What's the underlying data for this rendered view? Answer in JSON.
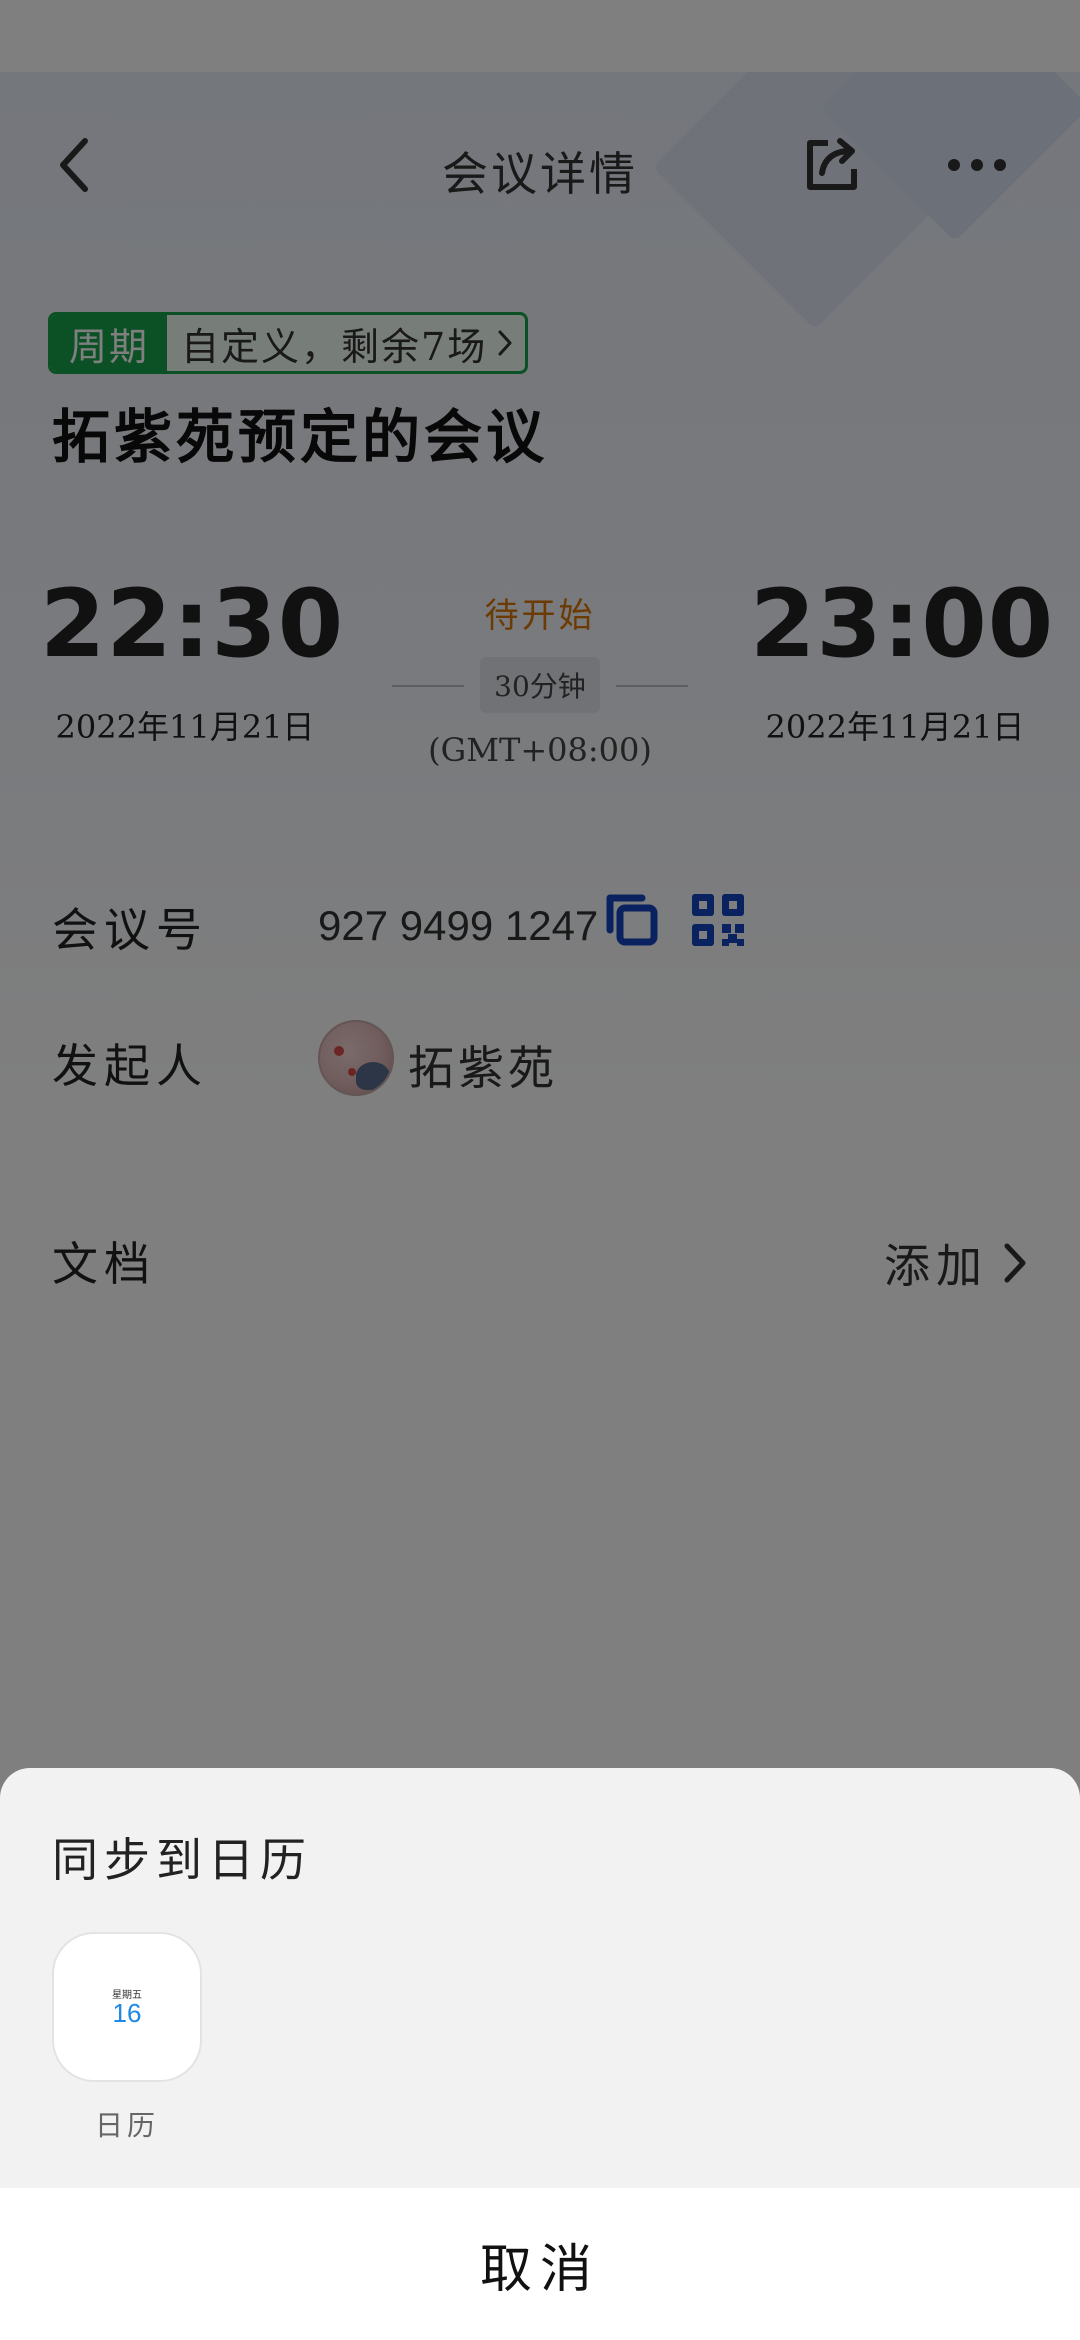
{
  "header": {
    "title": "会议详情"
  },
  "cycle": {
    "label": "周期",
    "text": "自定义，剩余7场"
  },
  "meeting": {
    "title": "拓紫苑预定的会议",
    "start": {
      "time": "22:30",
      "date": "2022年11月21日"
    },
    "end": {
      "time": "23:00",
      "date": "2022年11月21日"
    },
    "status": "待开始",
    "duration": "30分钟",
    "timezone": "(GMT+08:00)"
  },
  "details": {
    "meeting_id_label": "会议号",
    "meeting_id": "927 9499 1247",
    "organizer_label": "发起人",
    "organizer_name": "拓紫苑",
    "documents_label": "文档",
    "documents_action": "添加"
  },
  "sheet": {
    "title": "同步到日历",
    "apps": [
      {
        "label": "日历",
        "icon_weekday": "星期五",
        "icon_day": "16"
      }
    ],
    "cancel": "取消"
  },
  "colors": {
    "accent_green": "#16a34a",
    "status_orange": "#d97706",
    "action_blue": "#1447c0"
  },
  "icons": {
    "back": "chevron-left-icon",
    "share": "share-icon",
    "more": "more-horizontal-icon",
    "copy": "copy-icon",
    "qr": "qr-code-icon",
    "chevron": "chevron-right-icon"
  }
}
